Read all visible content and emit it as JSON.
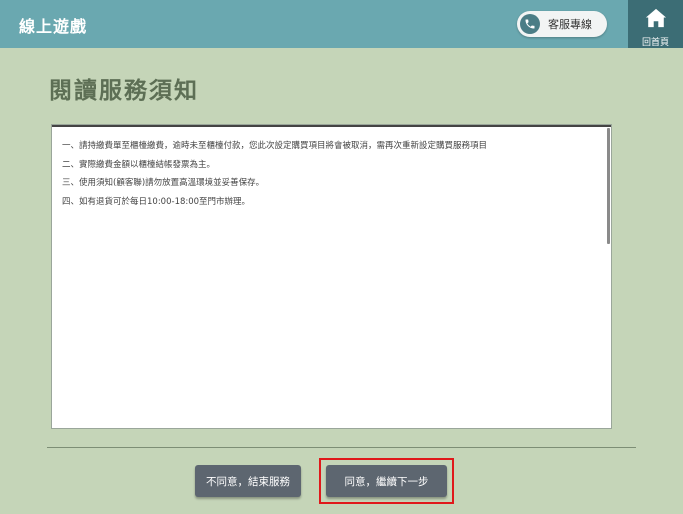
{
  "header": {
    "title": "線上遊戲",
    "customer_service_label": "客服專線",
    "customer_service_icon": "phone-icon",
    "home_label": "回首頁",
    "home_icon": "home-icon",
    "bar_color": "#6aa8b0",
    "home_color": "#3c6d75"
  },
  "main": {
    "page_title": "閱讀服務須知",
    "notice_items": [
      "一、請持繳費單至櫃檯繳費，逾時未至櫃檯付款，您此次設定購買項目將會被取消，需再次重新設定購買服務項目",
      "二、實際繳費金額以櫃檯結帳發票為主。",
      "三、使用須知(顧客聯)請勿放置高溫環境並妥善保存。",
      "四、如有退貨可於每日10:00-18:00至門市辦理。"
    ]
  },
  "footer": {
    "disagree_label": "不同意，結束服務",
    "agree_label": "同意，繼續下一步",
    "button_color": "#5d6670",
    "highlight_color": "#e0191b"
  }
}
